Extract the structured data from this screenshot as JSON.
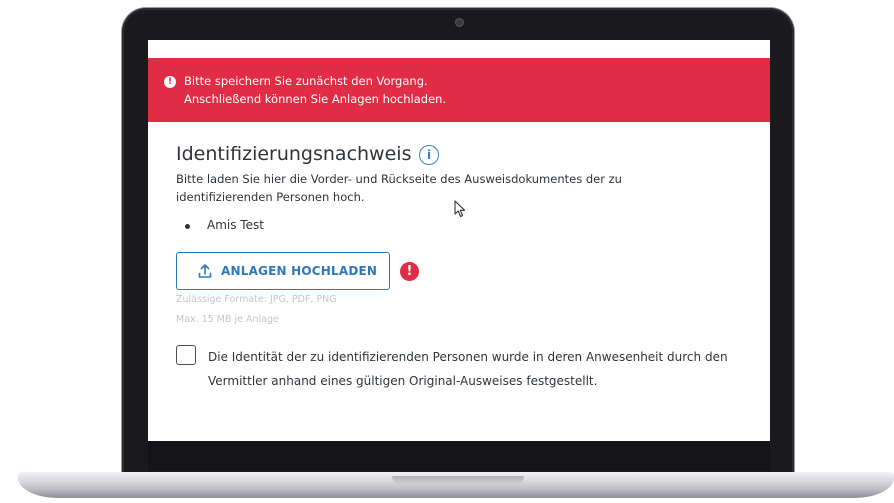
{
  "banner": {
    "line1": "Bitte speichern Sie zunächst den Vorgang.",
    "line2": "Anschließend können Sie Anlagen hochladen.",
    "icon": "alert-circle-icon",
    "color": "#e02c45"
  },
  "section": {
    "title": "Identifizierungsnachweis",
    "info_icon": "i",
    "description_line1": "Bitte laden Sie hier die Vorder- und Rückseite des Ausweisdokumentes der zu",
    "description_line2": "identifizierenden Personen hoch."
  },
  "persons": [
    "Amis Test"
  ],
  "upload": {
    "label": "ANLAGEN HOCHLADEN",
    "accent": "#2f78b7",
    "error_icon": "!"
  },
  "hints": {
    "formats": "Zulässige Formate: JPG, PDF, PNG",
    "max_size": "Max. 15 MB je Anlage"
  },
  "confirmation": {
    "checked": false,
    "line1": "Die Identität der zu identifizierenden Personen wurde in deren Anwesenheit durch den",
    "line2": "Vermittler anhand eines gültigen Original-Ausweises festgestellt."
  }
}
